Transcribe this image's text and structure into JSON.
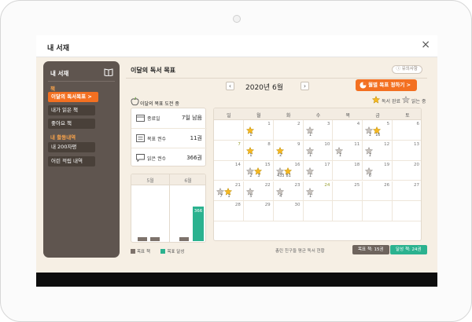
{
  "window": {
    "title": "내 서재",
    "close": "×"
  },
  "sidebar": {
    "header": "내 서재",
    "section_book": "책",
    "items_book": [
      {
        "label": "이달의 독서목표 >"
      },
      {
        "label": "내가 읽은 책"
      },
      {
        "label": "좋아요 책"
      }
    ],
    "section_activity": "내 활동내역",
    "items_activity": [
      {
        "label": "내 200자평"
      },
      {
        "label": "어린 적립 내역"
      }
    ]
  },
  "main": {
    "title": "이달의 독서 목표",
    "notice": "ⓘ 유의사항",
    "prev": "‹",
    "next": "›",
    "month": "2020년 6월",
    "set_goal": "월별 목표 정하기 >",
    "challenge": "이달의 목표 도전 중",
    "legend_done": "독서 완료",
    "legend_reading": "읽는 중",
    "stats": [
      {
        "label": "종료일",
        "value": "7일 남음"
      },
      {
        "label": "목표 권수",
        "value": "11권"
      },
      {
        "label": "읽은 권수",
        "value": "366권"
      }
    ],
    "bar_chart": {
      "months": [
        "5월",
        "6월"
      ],
      "goal_label": "목표 책",
      "done_label": "목표 달성",
      "done_value_label": "366",
      "colors": {
        "goal": "#7d726b",
        "done": "#2bb28f"
      }
    },
    "friend_label": "총린 친구들 평균 독서 현황",
    "friend_goal": "목표 책: 15권",
    "friend_done": "달성 책: 24권"
  },
  "calendar": {
    "weekdays": [
      "일",
      "월",
      "화",
      "수",
      "목",
      "금",
      "토"
    ],
    "days": [
      "",
      "1",
      "2",
      "3",
      "4",
      "5",
      "6",
      "7",
      "8",
      "9",
      "10",
      "11",
      "12",
      "13",
      "14",
      "15",
      "16",
      "17",
      "18",
      "19",
      "20",
      "21",
      "22",
      "23",
      "24",
      "25",
      "26",
      "27",
      "28",
      "29",
      "30",
      "",
      "",
      "",
      ""
    ],
    "highlight_days": [
      "7",
      "24"
    ],
    "marks": [
      {
        "cell": 1,
        "slot": 0,
        "type": "done",
        "count": "1"
      },
      {
        "cell": 3,
        "slot": 0,
        "type": "reading",
        "count": "1"
      },
      {
        "cell": 5,
        "slot": 0,
        "type": "reading",
        "count": "1"
      },
      {
        "cell": 5,
        "slot": 1,
        "type": "done",
        "count": "16"
      },
      {
        "cell": 8,
        "slot": 0,
        "type": "done",
        "count": "1"
      },
      {
        "cell": 9,
        "slot": 0,
        "type": "done",
        "count": "2"
      },
      {
        "cell": 10,
        "slot": 0,
        "type": "reading",
        "count": "1"
      },
      {
        "cell": 11,
        "slot": 0,
        "type": "reading",
        "count": "1"
      },
      {
        "cell": 12,
        "slot": 0,
        "type": "reading",
        "count": "1"
      },
      {
        "cell": 15,
        "slot": 0,
        "type": "reading",
        "count": "2"
      },
      {
        "cell": 15,
        "slot": 1,
        "type": "done",
        "count": "3"
      },
      {
        "cell": 16,
        "slot": 0,
        "type": "reading",
        "count": "433"
      },
      {
        "cell": 16,
        "slot": 1,
        "type": "done",
        "count": "81"
      },
      {
        "cell": 17,
        "slot": 0,
        "type": "reading",
        "count": "1"
      },
      {
        "cell": 19,
        "slot": 0,
        "type": "reading",
        "count": "6"
      },
      {
        "cell": 21,
        "slot": 0,
        "type": "reading",
        "count": "7"
      },
      {
        "cell": 21,
        "slot": 1,
        "type": "done",
        "count": "1"
      },
      {
        "cell": 22,
        "slot": 0,
        "type": "reading",
        "count": "5"
      },
      {
        "cell": 23,
        "slot": 0,
        "type": "reading",
        "count": "4"
      },
      {
        "cell": 24,
        "slot": 0,
        "type": "reading",
        "count": "1"
      }
    ],
    "colors": {
      "done": "#f7b820",
      "reading": "#c9c4bf"
    }
  },
  "colors": {
    "accent": "#f37021",
    "sidebar": "#5f554f",
    "green": "#2bb28f"
  }
}
